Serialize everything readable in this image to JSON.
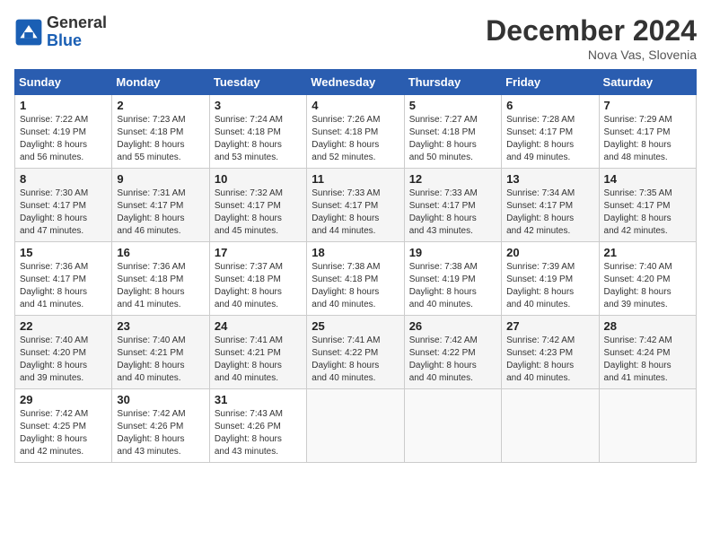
{
  "header": {
    "logo_general": "General",
    "logo_blue": "Blue",
    "month_title": "December 2024",
    "location": "Nova Vas, Slovenia"
  },
  "weekdays": [
    "Sunday",
    "Monday",
    "Tuesday",
    "Wednesday",
    "Thursday",
    "Friday",
    "Saturday"
  ],
  "weeks": [
    [
      {
        "day": "1",
        "info": "Sunrise: 7:22 AM\nSunset: 4:19 PM\nDaylight: 8 hours\nand 56 minutes."
      },
      {
        "day": "2",
        "info": "Sunrise: 7:23 AM\nSunset: 4:18 PM\nDaylight: 8 hours\nand 55 minutes."
      },
      {
        "day": "3",
        "info": "Sunrise: 7:24 AM\nSunset: 4:18 PM\nDaylight: 8 hours\nand 53 minutes."
      },
      {
        "day": "4",
        "info": "Sunrise: 7:26 AM\nSunset: 4:18 PM\nDaylight: 8 hours\nand 52 minutes."
      },
      {
        "day": "5",
        "info": "Sunrise: 7:27 AM\nSunset: 4:18 PM\nDaylight: 8 hours\nand 50 minutes."
      },
      {
        "day": "6",
        "info": "Sunrise: 7:28 AM\nSunset: 4:17 PM\nDaylight: 8 hours\nand 49 minutes."
      },
      {
        "day": "7",
        "info": "Sunrise: 7:29 AM\nSunset: 4:17 PM\nDaylight: 8 hours\nand 48 minutes."
      }
    ],
    [
      {
        "day": "8",
        "info": "Sunrise: 7:30 AM\nSunset: 4:17 PM\nDaylight: 8 hours\nand 47 minutes."
      },
      {
        "day": "9",
        "info": "Sunrise: 7:31 AM\nSunset: 4:17 PM\nDaylight: 8 hours\nand 46 minutes."
      },
      {
        "day": "10",
        "info": "Sunrise: 7:32 AM\nSunset: 4:17 PM\nDaylight: 8 hours\nand 45 minutes."
      },
      {
        "day": "11",
        "info": "Sunrise: 7:33 AM\nSunset: 4:17 PM\nDaylight: 8 hours\nand 44 minutes."
      },
      {
        "day": "12",
        "info": "Sunrise: 7:33 AM\nSunset: 4:17 PM\nDaylight: 8 hours\nand 43 minutes."
      },
      {
        "day": "13",
        "info": "Sunrise: 7:34 AM\nSunset: 4:17 PM\nDaylight: 8 hours\nand 42 minutes."
      },
      {
        "day": "14",
        "info": "Sunrise: 7:35 AM\nSunset: 4:17 PM\nDaylight: 8 hours\nand 42 minutes."
      }
    ],
    [
      {
        "day": "15",
        "info": "Sunrise: 7:36 AM\nSunset: 4:17 PM\nDaylight: 8 hours\nand 41 minutes."
      },
      {
        "day": "16",
        "info": "Sunrise: 7:36 AM\nSunset: 4:18 PM\nDaylight: 8 hours\nand 41 minutes."
      },
      {
        "day": "17",
        "info": "Sunrise: 7:37 AM\nSunset: 4:18 PM\nDaylight: 8 hours\nand 40 minutes."
      },
      {
        "day": "18",
        "info": "Sunrise: 7:38 AM\nSunset: 4:18 PM\nDaylight: 8 hours\nand 40 minutes."
      },
      {
        "day": "19",
        "info": "Sunrise: 7:38 AM\nSunset: 4:19 PM\nDaylight: 8 hours\nand 40 minutes."
      },
      {
        "day": "20",
        "info": "Sunrise: 7:39 AM\nSunset: 4:19 PM\nDaylight: 8 hours\nand 40 minutes."
      },
      {
        "day": "21",
        "info": "Sunrise: 7:40 AM\nSunset: 4:20 PM\nDaylight: 8 hours\nand 39 minutes."
      }
    ],
    [
      {
        "day": "22",
        "info": "Sunrise: 7:40 AM\nSunset: 4:20 PM\nDaylight: 8 hours\nand 39 minutes."
      },
      {
        "day": "23",
        "info": "Sunrise: 7:40 AM\nSunset: 4:21 PM\nDaylight: 8 hours\nand 40 minutes."
      },
      {
        "day": "24",
        "info": "Sunrise: 7:41 AM\nSunset: 4:21 PM\nDaylight: 8 hours\nand 40 minutes."
      },
      {
        "day": "25",
        "info": "Sunrise: 7:41 AM\nSunset: 4:22 PM\nDaylight: 8 hours\nand 40 minutes."
      },
      {
        "day": "26",
        "info": "Sunrise: 7:42 AM\nSunset: 4:22 PM\nDaylight: 8 hours\nand 40 minutes."
      },
      {
        "day": "27",
        "info": "Sunrise: 7:42 AM\nSunset: 4:23 PM\nDaylight: 8 hours\nand 40 minutes."
      },
      {
        "day": "28",
        "info": "Sunrise: 7:42 AM\nSunset: 4:24 PM\nDaylight: 8 hours\nand 41 minutes."
      }
    ],
    [
      {
        "day": "29",
        "info": "Sunrise: 7:42 AM\nSunset: 4:25 PM\nDaylight: 8 hours\nand 42 minutes."
      },
      {
        "day": "30",
        "info": "Sunrise: 7:42 AM\nSunset: 4:26 PM\nDaylight: 8 hours\nand 43 minutes."
      },
      {
        "day": "31",
        "info": "Sunrise: 7:43 AM\nSunset: 4:26 PM\nDaylight: 8 hours\nand 43 minutes."
      },
      {
        "day": "",
        "info": ""
      },
      {
        "day": "",
        "info": ""
      },
      {
        "day": "",
        "info": ""
      },
      {
        "day": "",
        "info": ""
      }
    ]
  ]
}
